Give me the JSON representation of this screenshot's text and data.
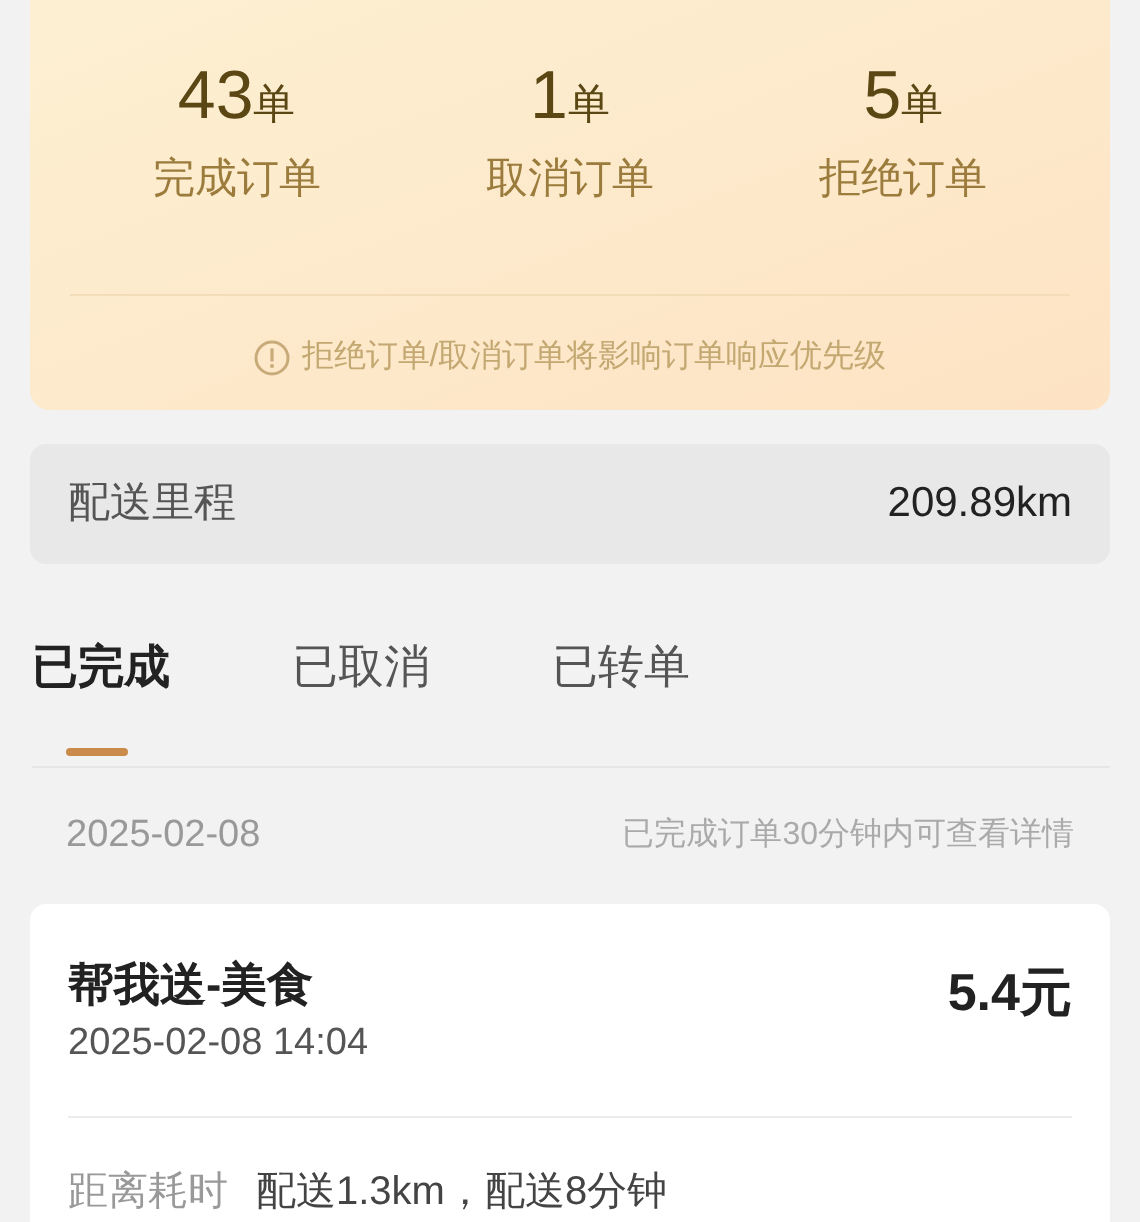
{
  "stats": [
    {
      "value": "43",
      "unit": "单",
      "label": "完成订单"
    },
    {
      "value": "1",
      "unit": "单",
      "label": "取消订单"
    },
    {
      "value": "5",
      "unit": "单",
      "label": "拒绝订单"
    }
  ],
  "notice": "拒绝订单/取消订单将影响订单响应优先级",
  "mileage": {
    "label": "配送里程",
    "value": "209.89km"
  },
  "tabs": [
    {
      "label": "已完成",
      "selected": true
    },
    {
      "label": "已取消",
      "selected": false
    },
    {
      "label": "已转单",
      "selected": false
    }
  ],
  "date_header": {
    "date": "2025-02-08",
    "hint": "已完成订单30分钟内可查看详情"
  },
  "order": {
    "title": "帮我送-美食",
    "time": "2025-02-08 14:04",
    "price": "5.4元",
    "detail_label": "距离耗时",
    "detail_value": "配送1.3km，配送8分钟"
  }
}
